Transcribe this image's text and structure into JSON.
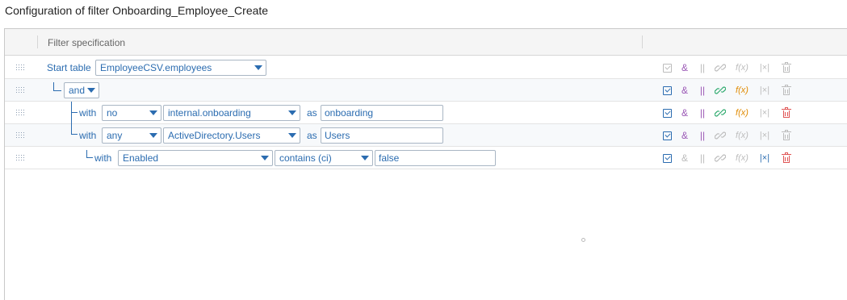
{
  "title": "Configuration of filter Onboarding_Employee_Create",
  "header": {
    "column_label": "Filter specification"
  },
  "colors": {
    "link_blue": "#2b6cb0",
    "green": "#2eaa6e",
    "purple": "#9b59b6",
    "orange": "#e08a00",
    "red": "#e05555",
    "disabled": "#bcbcbc"
  },
  "rows": [
    {
      "kind": "start",
      "label": "Start table",
      "table_select": "EmployeeCSV.employees",
      "actions": {
        "check": false,
        "and": true,
        "or": false,
        "link": false,
        "fx": false,
        "abs": false,
        "trash": false
      }
    },
    {
      "kind": "and",
      "operator_select": "and",
      "actions": {
        "check": true,
        "and": true,
        "or": true,
        "link": true,
        "fx": true,
        "abs": false,
        "trash": false
      }
    },
    {
      "kind": "with",
      "label": "with",
      "quantifier_select": "no",
      "table_select": "internal.onboarding",
      "as_label": "as",
      "alias_value": "onboarding",
      "actions": {
        "check": true,
        "and": true,
        "or": true,
        "link": true,
        "fx": true,
        "abs": false,
        "trash": true
      }
    },
    {
      "kind": "with",
      "label": "with",
      "quantifier_select": "any",
      "table_select": "ActiveDirectory.Users",
      "as_label": "as",
      "alias_value": "Users",
      "actions": {
        "check": true,
        "and": true,
        "or": true,
        "link": false,
        "fx": false,
        "abs": false,
        "trash": false
      }
    },
    {
      "kind": "condition",
      "label": "with",
      "field_select": "Enabled",
      "operator_select": "contains (ci)",
      "value": "false",
      "actions": {
        "check": true,
        "and": false,
        "or": false,
        "link": false,
        "fx": false,
        "abs": true,
        "trash": true
      }
    }
  ],
  "action_glyphs": {
    "and": "&",
    "or": "||",
    "fx": "f(x)",
    "abs": "|×|"
  },
  "icons": [
    "drag-handle-icon",
    "checkbox-icon",
    "and-icon",
    "or-icon",
    "link-icon",
    "function-icon",
    "absolute-icon",
    "trash-icon",
    "chevron-down-icon"
  ]
}
